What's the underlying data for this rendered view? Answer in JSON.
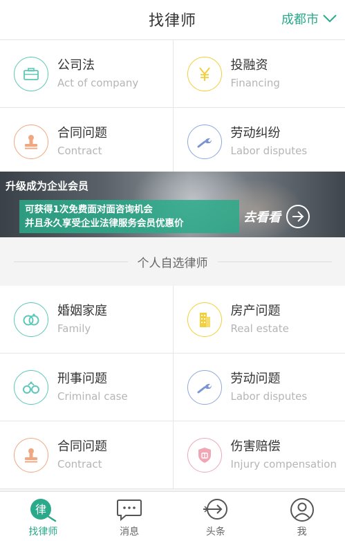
{
  "header": {
    "title": "找律师",
    "city": "成都市"
  },
  "top_categories": [
    {
      "cn": "公司法",
      "en": "Act of company",
      "icon": "briefcase-icon",
      "color": "teal"
    },
    {
      "cn": "投融资",
      "en": "Financing",
      "icon": "yen-icon",
      "color": "yellow"
    },
    {
      "cn": "合同问题",
      "en": "Contract",
      "icon": "stamp-icon",
      "color": "orange"
    },
    {
      "cn": "劳动纠纷",
      "en": "Labor disputes",
      "icon": "wrench-icon",
      "color": "blue"
    }
  ],
  "banner": {
    "title": "升级成为企业会员",
    "line1": "可获得1次免费面对面咨询机会",
    "line2": "并且永久享受企业法律服务会员优惠价",
    "cta": "去看看"
  },
  "section": {
    "title": "个人自选律师"
  },
  "personal_categories": [
    {
      "cn": "婚姻家庭",
      "en": "Family",
      "icon": "rings-icon",
      "color": "teal"
    },
    {
      "cn": "房产问题",
      "en": "Real estate",
      "icon": "building-icon",
      "color": "yellow"
    },
    {
      "cn": "刑事问题",
      "en": "Criminal case",
      "icon": "handcuffs-icon",
      "color": "teal"
    },
    {
      "cn": "劳动问题",
      "en": "Labor disputes",
      "icon": "wrench-icon",
      "color": "blue"
    },
    {
      "cn": "合同问题",
      "en": "Contract",
      "icon": "stamp-icon",
      "color": "orange"
    },
    {
      "cn": "伤害赔偿",
      "en": "Injury compensation",
      "icon": "shield-compensation-icon",
      "color": "pink"
    }
  ],
  "tabbar": {
    "items": [
      {
        "label": "找律师",
        "icon": "lawyer-icon",
        "active": true
      },
      {
        "label": "消息",
        "icon": "chat-icon",
        "active": false
      },
      {
        "label": "头条",
        "icon": "headline-arrow-icon",
        "active": false
      },
      {
        "label": "我",
        "icon": "user-icon",
        "active": false
      }
    ],
    "active_color": "#2aaa8a"
  },
  "colors": {
    "accent": "#2aaa8a",
    "teal": "#5cc8b8",
    "yellow": "#f3cf3a",
    "orange": "#f0a882",
    "blue": "#8fa7dd",
    "pink": "#f0a6b5"
  }
}
